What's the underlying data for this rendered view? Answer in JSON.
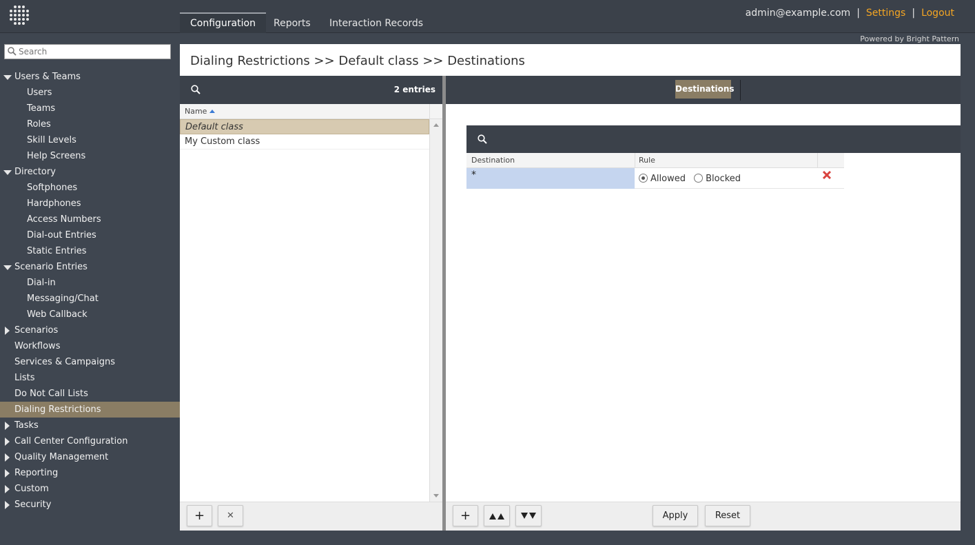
{
  "header": {
    "tabs": [
      {
        "label": "Configuration",
        "active": true
      },
      {
        "label": "Reports",
        "active": false
      },
      {
        "label": "Interaction Records",
        "active": false
      }
    ],
    "user_email": "admin@example.com",
    "separator": "|",
    "settings_label": "Settings",
    "logout_label": "Logout",
    "powered_by": "Powered by Bright Pattern",
    "accent_color": "#f5a623"
  },
  "sidebar": {
    "search_placeholder": "Search",
    "items": [
      {
        "label": "Users & Teams",
        "level": 0,
        "expander": "down"
      },
      {
        "label": "Users",
        "level": 1
      },
      {
        "label": "Teams",
        "level": 1
      },
      {
        "label": "Roles",
        "level": 1
      },
      {
        "label": "Skill Levels",
        "level": 1
      },
      {
        "label": "Help Screens",
        "level": 1
      },
      {
        "label": "Directory",
        "level": 0,
        "expander": "down"
      },
      {
        "label": "Softphones",
        "level": 1
      },
      {
        "label": "Hardphones",
        "level": 1
      },
      {
        "label": "Access Numbers",
        "level": 1
      },
      {
        "label": "Dial-out Entries",
        "level": 1
      },
      {
        "label": "Static Entries",
        "level": 1
      },
      {
        "label": "Scenario Entries",
        "level": 0,
        "expander": "down"
      },
      {
        "label": "Dial-in",
        "level": 1
      },
      {
        "label": "Messaging/Chat",
        "level": 1
      },
      {
        "label": "Web Callback",
        "level": 1
      },
      {
        "label": "Scenarios",
        "level": 0,
        "expander": "right"
      },
      {
        "label": "Workflows",
        "level": 0
      },
      {
        "label": "Services & Campaigns",
        "level": 0
      },
      {
        "label": "Lists",
        "level": 0
      },
      {
        "label": "Do Not Call Lists",
        "level": 0
      },
      {
        "label": "Dialing Restrictions",
        "level": 0,
        "selected": true
      },
      {
        "label": "Tasks",
        "level": 0,
        "expander": "right"
      },
      {
        "label": "Call Center Configuration",
        "level": 0,
        "expander": "right"
      },
      {
        "label": "Quality Management",
        "level": 0,
        "expander": "right"
      },
      {
        "label": "Reporting",
        "level": 0,
        "expander": "right"
      },
      {
        "label": "Custom",
        "level": 0,
        "expander": "right"
      },
      {
        "label": "Security",
        "level": 0,
        "expander": "right"
      }
    ],
    "selected_color": "#8a7d64"
  },
  "main": {
    "breadcrumb": "Dialing Restrictions >> Default class >> Destinations",
    "list": {
      "count_label": "2 entries",
      "column_name": "Name",
      "rows": [
        {
          "name": "Default class",
          "selected": true
        },
        {
          "name": "My Custom class",
          "selected": false
        }
      ],
      "add_label": "+",
      "delete_label": "✕"
    },
    "detail": {
      "tab_label": "Destinations",
      "columns": {
        "destination": "Destination",
        "rule": "Rule"
      },
      "rows": [
        {
          "destination": "*",
          "rule": "Allowed",
          "options": [
            "Allowed",
            "Blocked"
          ]
        }
      ],
      "buttons": {
        "add": "+",
        "move_up": "⏶⏶",
        "move_down": "⏷⏷",
        "apply": "Apply",
        "reset": "Reset"
      }
    }
  }
}
